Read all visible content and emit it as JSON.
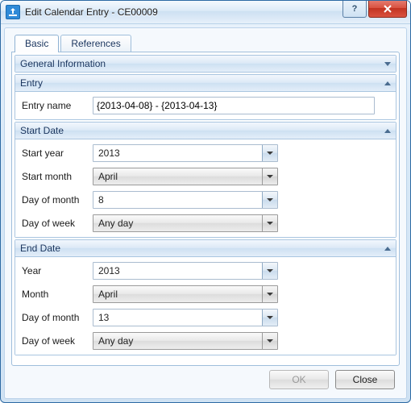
{
  "title": "Edit Calendar Entry - CE00009",
  "tabs": {
    "basic": "Basic",
    "references": "References"
  },
  "sections": {
    "general": "General Information",
    "entry": "Entry",
    "start": "Start Date",
    "end": "End Date"
  },
  "labels": {
    "entry_name": "Entry name",
    "start_year": "Start year",
    "start_month": "Start month",
    "start_dom": "Day of month",
    "start_dow": "Day of week",
    "end_year": "Year",
    "end_month": "Month",
    "end_dom": "Day of month",
    "end_dow": "Day of week"
  },
  "values": {
    "entry_name": "{2013-04-08} - {2013-04-13}",
    "start_year": "2013",
    "start_month": "April",
    "start_dom": "8",
    "start_dow": "Any day",
    "end_year": "2013",
    "end_month": "April",
    "end_dom": "13",
    "end_dow": "Any day"
  },
  "buttons": {
    "ok": "OK",
    "close": "Close"
  }
}
